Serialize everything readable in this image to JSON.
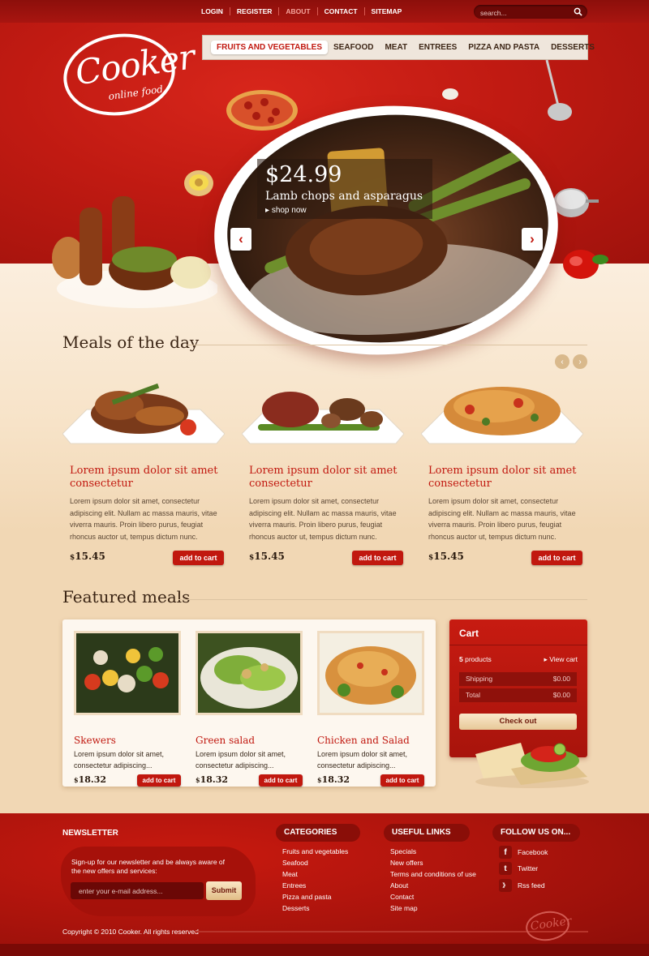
{
  "top_nav": {
    "items": [
      "LOGIN",
      "REGISTER",
      "ABOUT",
      "CONTACT",
      "SITEMAP"
    ],
    "active": "ABOUT"
  },
  "search": {
    "placeholder": "search..."
  },
  "logo": {
    "main": "Cooker",
    "sub": "online food"
  },
  "categories": [
    "FRUITS AND VEGETABLES",
    "SEAFOOD",
    "MEAT",
    "ENTREES",
    "PIZZA AND PASTA",
    "DESSERTS"
  ],
  "slider": {
    "price": "$24.99",
    "title": "Lamb chops and asparagus",
    "link": "shop now",
    "prev": "‹",
    "next": "›"
  },
  "meals_section": {
    "title": "Meals of the day",
    "prev": "‹",
    "next": "›",
    "items": [
      {
        "title": "Lorem ipsum dolor sit amet consectetur",
        "text": "Lorem ipsum dolor sit amet, consectetur adipiscing elit. Nullam ac massa mauris, vitae viverra mauris. Proin libero purus, feugiat rhoncus auctor ut, tempus dictum nunc.",
        "currency": "$",
        "price": "15.45",
        "button": "add to cart"
      },
      {
        "title": "Lorem ipsum dolor sit amet consectetur",
        "text": "Lorem ipsum dolor sit amet, consectetur adipiscing elit. Nullam ac massa mauris, vitae viverra mauris. Proin libero purus, feugiat rhoncus auctor ut, tempus dictum nunc.",
        "currency": "$",
        "price": "15.45",
        "button": "add to cart"
      },
      {
        "title": "Lorem ipsum dolor sit amet consectetur",
        "text": "Lorem ipsum dolor sit amet, consectetur adipiscing elit. Nullam ac massa mauris, vitae viverra mauris. Proin libero purus, feugiat rhoncus auctor ut, tempus dictum nunc.",
        "currency": "$",
        "price": "15.45",
        "button": "add to cart"
      }
    ]
  },
  "featured_section": {
    "title": "Featured meals",
    "items": [
      {
        "title": "Skewers",
        "text": "Lorem ipsum dolor sit amet, consectetur adipiscing...",
        "currency": "$",
        "price": "18.32",
        "button": "add to cart"
      },
      {
        "title": "Green salad",
        "text": "Lorem ipsum dolor sit amet, consectetur adipiscing...",
        "currency": "$",
        "price": "18.32",
        "button": "add to cart"
      },
      {
        "title": "Chicken and Salad",
        "text": "Lorem ipsum dolor sit amet, consectetur adipiscing...",
        "currency": "$",
        "price": "18.32",
        "button": "add to cart"
      }
    ]
  },
  "cart": {
    "title": "Cart",
    "count": "5",
    "count_label": "products",
    "view": "View cart",
    "shipping_label": "Shipping",
    "shipping_value": "$0.00",
    "total_label": "Total",
    "total_value": "$0.00",
    "checkout": "Check out"
  },
  "footer": {
    "newsletter": {
      "title": "NEWSLETTER",
      "text": "Sign-up for our newsletter and be always aware of the new offers and services:",
      "placeholder": "enter your e-mail address...",
      "button": "Submit"
    },
    "categories": {
      "title": "CATEGORIES",
      "items": [
        "Fruits and vegetables",
        "Seafood",
        "Meat",
        "Entrees",
        "Pizza and pasta",
        "Desserts"
      ]
    },
    "useful_links": {
      "title": "USEFUL LINKS",
      "items": [
        "Specials",
        "New offers",
        "Terms and conditions of use",
        "About",
        "Contact",
        "Site map"
      ]
    },
    "follow": {
      "title": "FOLLOW US ON...",
      "items": [
        {
          "icon": "facebook-icon",
          "glyph": "f",
          "label": "Facebook"
        },
        {
          "icon": "twitter-icon",
          "glyph": "t",
          "label": "Twitter"
        },
        {
          "icon": "rss-icon",
          "glyph": "》",
          "label": "Rss feed"
        }
      ]
    },
    "copyright": "Copyright © 2010 Cooker. All rights reserved",
    "logo": "Cooker"
  },
  "colors": {
    "brand_red": "#c1180f",
    "dark_red": "#8a0e08",
    "cream": "#f7e3c8",
    "text_brown": "#3a2414"
  }
}
